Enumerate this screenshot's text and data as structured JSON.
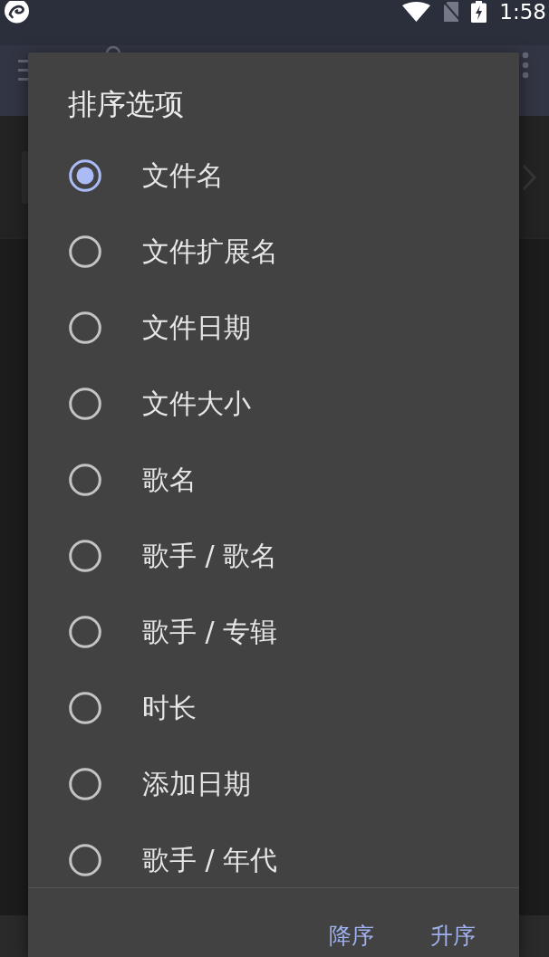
{
  "status_bar": {
    "time": "1:58"
  },
  "dialog": {
    "title": "排序选项",
    "options": [
      {
        "label": "文件名",
        "selected": true
      },
      {
        "label": "文件扩展名",
        "selected": false
      },
      {
        "label": "文件日期",
        "selected": false
      },
      {
        "label": "文件大小",
        "selected": false
      },
      {
        "label": "歌名",
        "selected": false
      },
      {
        "label": "歌手 / 歌名",
        "selected": false
      },
      {
        "label": "歌手 / 专辑",
        "selected": false
      },
      {
        "label": "时长",
        "selected": false
      },
      {
        "label": "添加日期",
        "selected": false
      },
      {
        "label": "歌手 / 年代",
        "selected": false
      }
    ],
    "buttons": [
      "降序",
      "升序"
    ]
  }
}
